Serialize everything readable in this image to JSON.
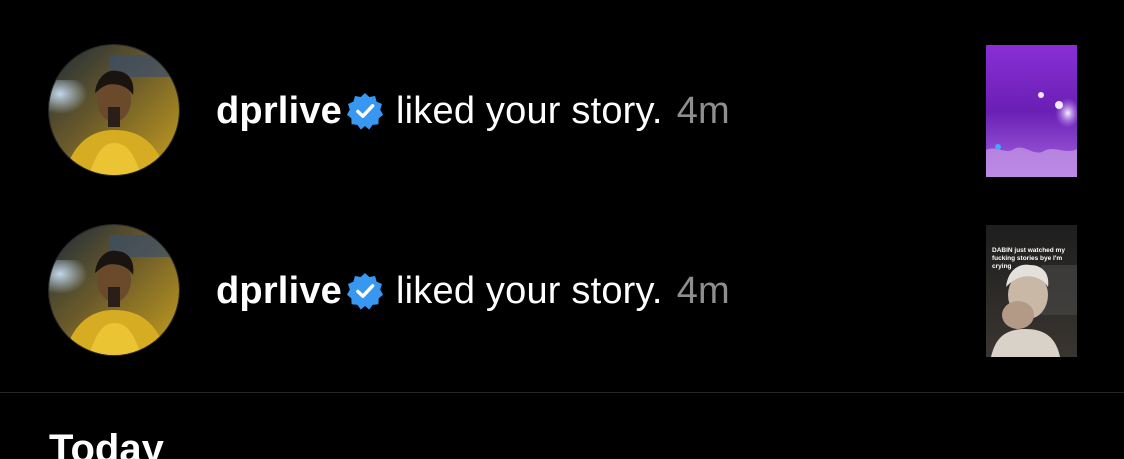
{
  "notifications": [
    {
      "username": "dprlive",
      "verified_icon": "verified-badge-icon",
      "action": "liked your story.",
      "time": "4m",
      "thumbnail": {
        "caption": ""
      }
    },
    {
      "username": "dprlive",
      "verified_icon": "verified-badge-icon",
      "action": "liked your story.",
      "time": "4m",
      "thumbnail": {
        "caption": "DABIN just watched my fucking stories bye I'm crying"
      }
    }
  ],
  "section": {
    "heading": "Today"
  },
  "colors": {
    "background": "#000000",
    "text": "#ffffff",
    "muted": "#8e8e8e",
    "verified": "#3897f0",
    "divider": "#262626"
  }
}
